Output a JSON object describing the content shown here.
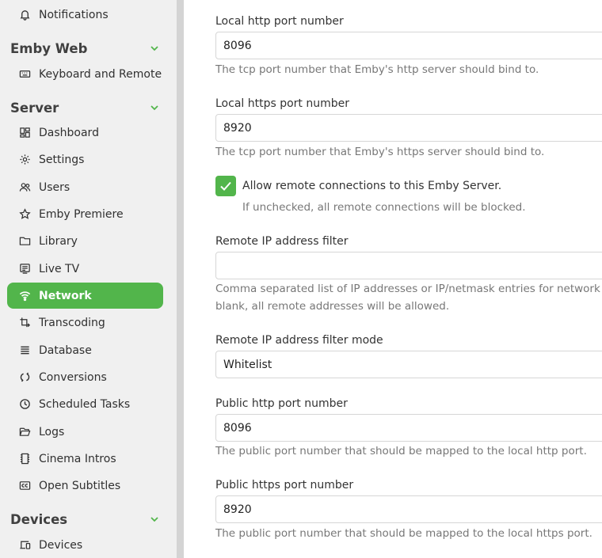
{
  "sidebar": {
    "top_item": {
      "label": "Notifications",
      "icon": "bell-icon"
    },
    "sections": [
      {
        "title": "Emby Web",
        "items": [
          {
            "label": "Keyboard and Remote",
            "icon": "keyboard-icon"
          }
        ]
      },
      {
        "title": "Server",
        "items": [
          {
            "label": "Dashboard",
            "icon": "dashboard-icon"
          },
          {
            "label": "Settings",
            "icon": "gear-icon"
          },
          {
            "label": "Users",
            "icon": "users-icon"
          },
          {
            "label": "Emby Premiere",
            "icon": "star-icon"
          },
          {
            "label": "Library",
            "icon": "folder-icon"
          },
          {
            "label": "Live TV",
            "icon": "tv-guide-icon"
          },
          {
            "label": "Network",
            "icon": "wifi-icon",
            "active": true
          },
          {
            "label": "Transcoding",
            "icon": "transcode-icon"
          },
          {
            "label": "Database",
            "icon": "database-icon"
          },
          {
            "label": "Conversions",
            "icon": "sync-icon"
          },
          {
            "label": "Scheduled Tasks",
            "icon": "clock-icon"
          },
          {
            "label": "Logs",
            "icon": "folder-open-icon"
          },
          {
            "label": "Cinema Intros",
            "icon": "film-icon"
          },
          {
            "label": "Open Subtitles",
            "icon": "closed-caption-icon"
          }
        ]
      },
      {
        "title": "Devices",
        "items": [
          {
            "label": "Devices",
            "icon": "devices-icon"
          }
        ]
      }
    ]
  },
  "form": {
    "local_http": {
      "label": "Local http port number",
      "value": "8096",
      "help": "The tcp port number that Emby's http server should bind to."
    },
    "local_https": {
      "label": "Local https port number",
      "value": "8920",
      "help": "The tcp port number that Emby's https server should bind to."
    },
    "remote": {
      "label": "Allow remote connections to this Emby Server.",
      "checked": true,
      "help": "If unchecked, all remote connections will be blocked."
    },
    "ip_filter": {
      "label": "Remote IP address filter",
      "value": "",
      "help_line1": "Comma separated list of IP addresses or IP/netmask entries for network",
      "help_line2": "blank, all remote addresses will be allowed."
    },
    "ip_filter_mode": {
      "label": "Remote IP address filter mode",
      "value": "Whitelist"
    },
    "public_http": {
      "label": "Public http port number",
      "value": "8096",
      "help": "The public port number that should be mapped to the local http port."
    },
    "public_https": {
      "label": "Public https port number",
      "value": "8920",
      "help": "The public port number that should be mapped to the local https port."
    }
  },
  "colors": {
    "accent": "#52b54b",
    "sidebar_bg": "#f0f0f0"
  }
}
